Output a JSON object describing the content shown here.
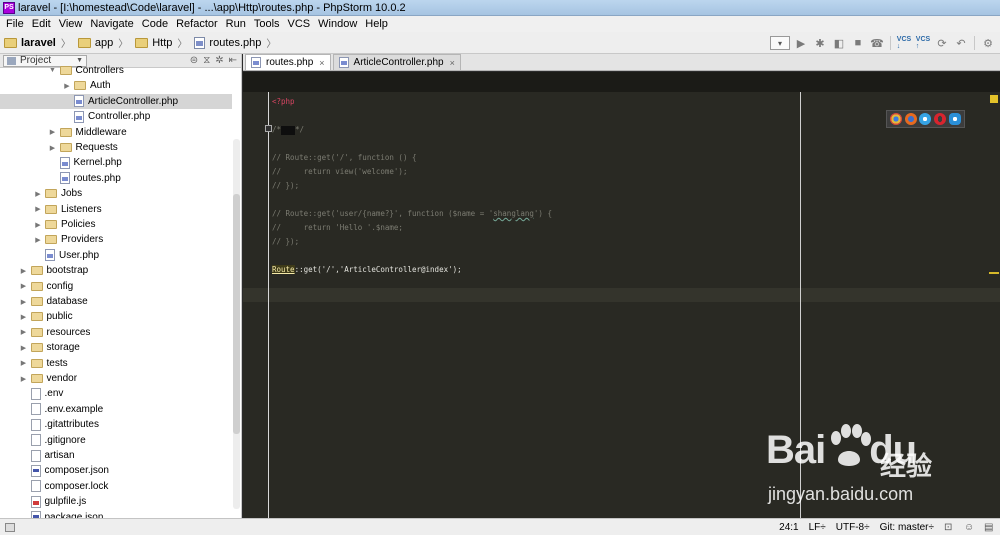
{
  "window": {
    "title": "laravel - [I:\\homestead\\Code\\laravel] - ...\\app\\Http\\routes.php - PhpStorm 10.0.2"
  },
  "menu": [
    "File",
    "Edit",
    "View",
    "Navigate",
    "Code",
    "Refactor",
    "Run",
    "Tools",
    "VCS",
    "Window",
    "Help"
  ],
  "breadcrumb": [
    {
      "label": "laravel",
      "type": "folder"
    },
    {
      "label": "app",
      "type": "folder"
    },
    {
      "label": "Http",
      "type": "folder"
    },
    {
      "label": "routes.php",
      "type": "php"
    }
  ],
  "project_panel": {
    "view_label": "Project"
  },
  "tree": [
    {
      "label": "Controllers",
      "type": "folder",
      "depth": 3,
      "expanded": true
    },
    {
      "label": "Auth",
      "type": "folder",
      "depth": 4,
      "expanded": false
    },
    {
      "label": "ArticleController.php",
      "type": "php",
      "depth": 4,
      "selected": true
    },
    {
      "label": "Controller.php",
      "type": "php",
      "depth": 4
    },
    {
      "label": "Middleware",
      "type": "folder",
      "depth": 3,
      "expanded": false
    },
    {
      "label": "Requests",
      "type": "folder",
      "depth": 3,
      "expanded": false
    },
    {
      "label": "Kernel.php",
      "type": "php",
      "depth": 3
    },
    {
      "label": "routes.php",
      "type": "php",
      "depth": 3
    },
    {
      "label": "Jobs",
      "type": "folder",
      "depth": 2,
      "expanded": false
    },
    {
      "label": "Listeners",
      "type": "folder",
      "depth": 2,
      "expanded": false
    },
    {
      "label": "Policies",
      "type": "folder",
      "depth": 2,
      "expanded": false
    },
    {
      "label": "Providers",
      "type": "folder",
      "depth": 2,
      "expanded": false
    },
    {
      "label": "User.php",
      "type": "php",
      "depth": 2
    },
    {
      "label": "bootstrap",
      "type": "folder",
      "depth": 1,
      "expanded": false
    },
    {
      "label": "config",
      "type": "folder",
      "depth": 1,
      "expanded": false
    },
    {
      "label": "database",
      "type": "folder",
      "depth": 1,
      "expanded": false
    },
    {
      "label": "public",
      "type": "folder",
      "depth": 1,
      "expanded": false
    },
    {
      "label": "resources",
      "type": "folder",
      "depth": 1,
      "expanded": false
    },
    {
      "label": "storage",
      "type": "folder",
      "depth": 1,
      "expanded": false
    },
    {
      "label": "tests",
      "type": "folder",
      "depth": 1,
      "expanded": false
    },
    {
      "label": "vendor",
      "type": "folder",
      "depth": 1,
      "expanded": false
    },
    {
      "label": ".env",
      "type": "file",
      "depth": 1
    },
    {
      "label": ".env.example",
      "type": "file",
      "depth": 1
    },
    {
      "label": ".gitattributes",
      "type": "file",
      "depth": 1
    },
    {
      "label": ".gitignore",
      "type": "file",
      "depth": 1
    },
    {
      "label": "artisan",
      "type": "file",
      "depth": 1
    },
    {
      "label": "composer.json",
      "type": "json",
      "depth": 1
    },
    {
      "label": "composer.lock",
      "type": "file",
      "depth": 1
    },
    {
      "label": "gulpfile.js",
      "type": "js",
      "depth": 1
    },
    {
      "label": "package.json",
      "type": "json",
      "depth": 1
    }
  ],
  "editor_tabs": [
    {
      "label": "routes.php",
      "active": true
    },
    {
      "label": "ArticleController.php",
      "active": false
    }
  ],
  "code": {
    "php_open": "<?php",
    "fold_open": "/*",
    "fold_close": "*/",
    "c1": "// Route::get('/', function () {",
    "c2": "//     return view('welcome');",
    "c3": "// });",
    "c4_a": "// Route::get('user/{name?}', function ($name = '",
    "c4_name": "shanglang",
    "c4_b": "') {",
    "c5": "//     return 'Hello '.$name;",
    "c6": "// });",
    "route_kw": "Route",
    "route_rest": "::get('/','ArticleController@index');"
  },
  "status": {
    "position": "24:1",
    "line_sep": "LF÷",
    "encoding": "UTF-8÷",
    "vcs": "Git: master÷"
  },
  "watermark": {
    "brand": "Bai",
    "brand_tail": "du",
    "cn": "经验",
    "url": "jingyan.baidu.com"
  }
}
